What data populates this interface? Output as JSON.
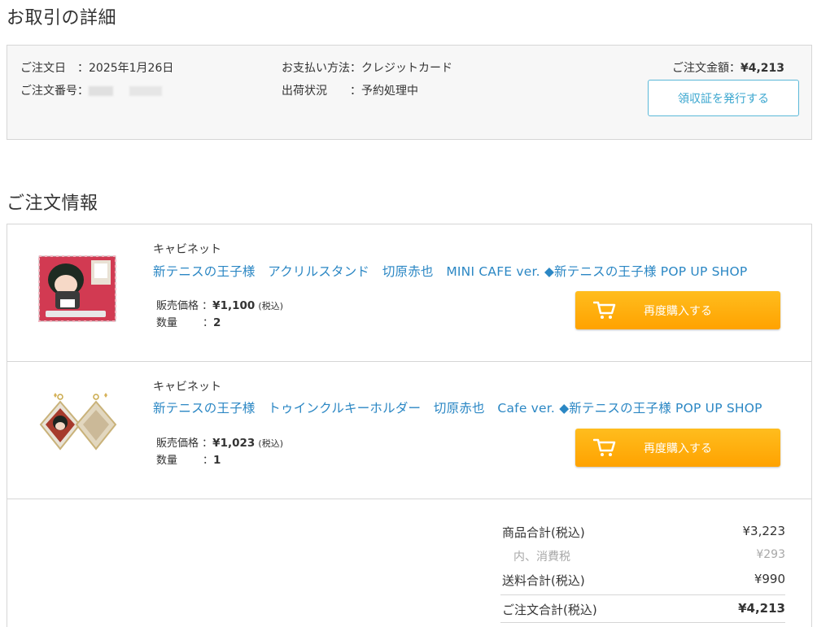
{
  "page_title": "お取引の詳細",
  "summary": {
    "order_date_label": "ご注文日　：",
    "order_date": "2025年1月26日",
    "order_no_label": "ご注文番号：",
    "payment_label": "お支払い方法：",
    "payment_value": "クレジットカード",
    "shipping_label": "出荷状況　　：",
    "shipping_value": "予約処理中",
    "amount_label": "ご注文金額：",
    "amount_value": "¥4,213",
    "receipt_button": "領収証を発行する"
  },
  "section_title": "ご注文情報",
  "items": [
    {
      "shop": "キャビネット",
      "title": "新テニスの王子様　アクリルスタンド　切原赤也　MINI CAFE ver. ◆新テニスの王子様 POP UP SHOP",
      "price_label": "販売価格",
      "price_sep": "：",
      "price_value": "¥1,100",
      "price_tax": "(税込)",
      "qty_label": "数量",
      "qty_sep": "：",
      "qty_value": "2",
      "rebuy_label": "再度購入する"
    },
    {
      "shop": "キャビネット",
      "title": "新テニスの王子様　トゥインクルキーホルダー　切原赤也　Cafe ver. ◆新テニスの王子様 POP UP SHOP",
      "price_label": "販売価格",
      "price_sep": "：",
      "price_value": "¥1,023",
      "price_tax": "(税込)",
      "qty_label": "数量",
      "qty_sep": "：",
      "qty_value": "1",
      "rebuy_label": "再度購入する"
    }
  ],
  "totals": {
    "subtotal_label": "商品合計(税込)",
    "subtotal_value": "¥3,223",
    "tax_label": "内、消費税",
    "tax_value": "¥293",
    "shipping_label": "送料合計(税込)",
    "shipping_value": "¥990",
    "grand_label": "ご注文合計(税込)",
    "grand_value": "¥4,213"
  },
  "colors": {
    "link": "#2b87c4",
    "rebuy_button": "#ffa200",
    "receipt_border": "#5bb8d8",
    "summary_bg": "#f7f7f7"
  },
  "icons": [
    "cart-icon"
  ]
}
